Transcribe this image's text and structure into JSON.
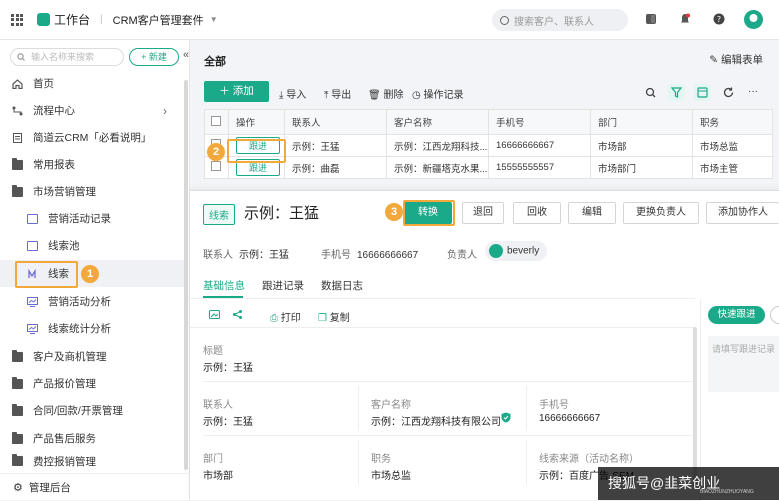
{
  "topbar": {
    "workspace_label": "工作台",
    "app_title": "CRM客户管理套件",
    "search_placeholder": "搜索客户、联系人"
  },
  "sidebar": {
    "search_placeholder": "输入名称来搜索",
    "new_label": "+ 新建",
    "items": [
      {
        "label": "首页",
        "icon": "home-icon"
      },
      {
        "label": "流程中心",
        "icon": "flow-icon"
      },
      {
        "label": "简道云CRM「必看说明」",
        "icon": "doc-icon"
      },
      {
        "label": "常用报表",
        "icon": "folder-icon"
      },
      {
        "label": "市场营销管理",
        "icon": "folder-icon"
      },
      {
        "label": "营销活动记录",
        "icon": "form-icon"
      },
      {
        "label": "线索池",
        "icon": "form-icon"
      },
      {
        "label": "线索",
        "icon": "lead-icon"
      },
      {
        "label": "营销活动分析",
        "icon": "chart-icon"
      },
      {
        "label": "线索统计分析",
        "icon": "chart-icon"
      },
      {
        "label": "客户及商机管理",
        "icon": "folder-icon"
      },
      {
        "label": "产品报价管理",
        "icon": "folder-icon"
      },
      {
        "label": "合同/回款/开票管理",
        "icon": "folder-icon"
      },
      {
        "label": "产品售后服务",
        "icon": "folder-icon"
      },
      {
        "label": "费控报销管理",
        "icon": "folder-icon"
      }
    ],
    "footer_label": "管理后台"
  },
  "annotations": [
    "1",
    "2",
    "3"
  ],
  "main": {
    "title": "全部",
    "edit_form": "编辑表单",
    "add_label": "添加",
    "tools": [
      "导入",
      "导出",
      "删除",
      "操作记录"
    ],
    "columns": [
      "操作",
      "联系人",
      "客户名称",
      "手机号",
      "部门",
      "职务"
    ],
    "rows": [
      {
        "action": "跟进",
        "contact": "示例：王猛",
        "customer": "示例：江西龙翔科技...",
        "phone": "16666666667",
        "dept": "市场部",
        "title": "市场总监"
      },
      {
        "action": "跟进",
        "contact": "示例：曲磊",
        "customer": "示例：新疆塔克水果...",
        "phone": "15555555557",
        "dept": "市场部门",
        "title": "市场主管"
      }
    ]
  },
  "detail": {
    "tag": "线索",
    "title": "示例：王猛",
    "buttons": [
      "转换",
      "退回",
      "回收",
      "编辑",
      "更换负责人",
      "添加协作人"
    ],
    "contact_label": "联系人",
    "contact_value": "示例：王猛",
    "phone_label": "手机号",
    "phone_value": "16666666667",
    "owner_label": "负责人",
    "owner_value": "beverly",
    "tabs": [
      "基础信息",
      "跟进记录",
      "数据日志"
    ],
    "subtools": [
      "打印",
      "复制"
    ],
    "quick_follow": "快速跟进",
    "note_placeholder": "请填写跟进记录",
    "fields": {
      "biaoti_label": "标题",
      "biaoti_value": "示例：王猛",
      "lxr_label": "联系人",
      "lxr_value": "示例：王猛",
      "khmc_label": "客户名称",
      "khmc_value": "示例：江西龙翔科技有限公司",
      "sjh_label": "手机号",
      "sjh_value": "16666666667",
      "bm_label": "部门",
      "bm_value": "市场部",
      "zw_label": "职务",
      "zw_value": "市场总监",
      "xsly_label": "线索来源（活动名称）",
      "xsly_value": "示例：百度广告-SEM"
    }
  },
  "watermark": {
    "text": "搜狐号@韭菜创业",
    "sub": "BIAOZHUNZHUOYANG"
  },
  "colors": {
    "accent": "#1aaa8a",
    "annotation": "#f3a83b"
  }
}
